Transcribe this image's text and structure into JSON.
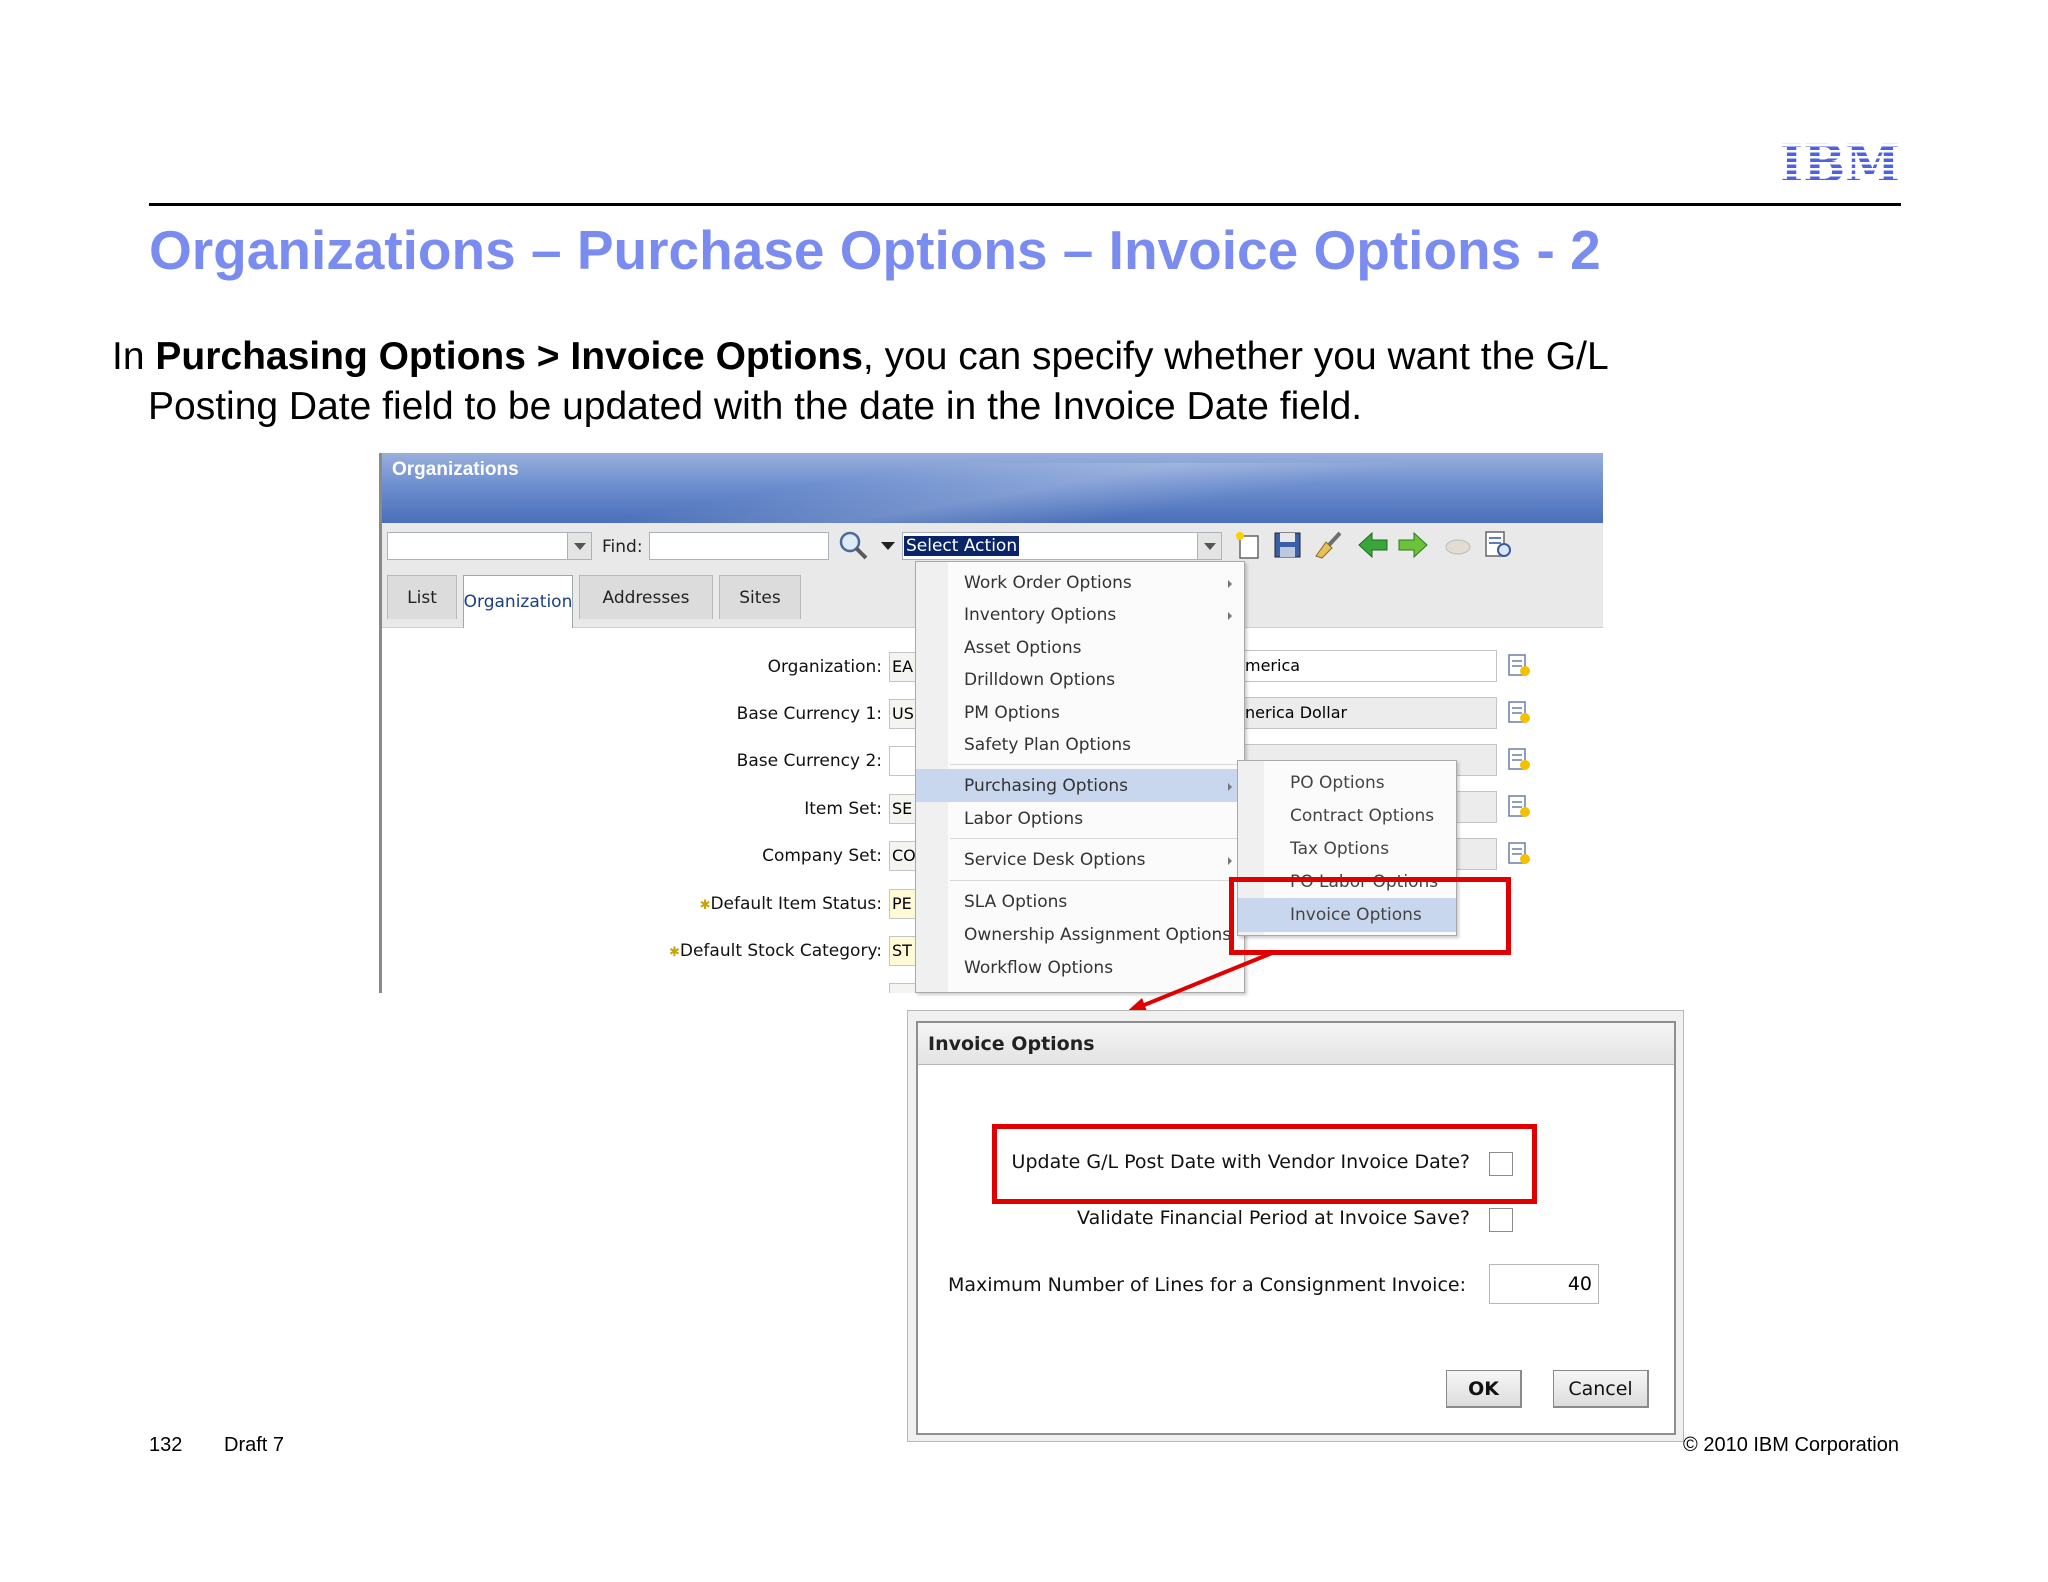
{
  "slide": {
    "logo_text": "IBM",
    "title": "Organizations – Purchase Options – Invoice Options - 2",
    "body": {
      "prefix": "In ",
      "bold": "Purchasing Options > Invoice Options",
      "rest_line1": ", you can specify whether you want the G/L",
      "line2": "Posting Date field to be updated with the date in the Invoice Date field."
    },
    "footer": {
      "page_number": "132",
      "draft": "Draft 7",
      "copyright": "© 2010 IBM Corporation"
    }
  },
  "app": {
    "title": "Organizations",
    "toolbar": {
      "find_label": "Find:",
      "select_action": "Select Action"
    },
    "tabs": [
      {
        "label": "List"
      },
      {
        "label": "Organization"
      },
      {
        "label": "Addresses"
      },
      {
        "label": "Sites"
      }
    ],
    "fields": [
      {
        "label": "Organization:",
        "value": "EA",
        "desc": "merica"
      },
      {
        "label": "Base Currency 1:",
        "value": "US",
        "desc": "nerica Dollar"
      },
      {
        "label": "Base Currency 2:",
        "value": "",
        "desc": ""
      },
      {
        "label": "Item Set:",
        "value": "SE",
        "desc": ""
      },
      {
        "label": "Company Set:",
        "value": "CO",
        "desc": ""
      },
      {
        "label": "Default Item Status:",
        "value": "PE",
        "required": true
      },
      {
        "label": "Default Stock Category:",
        "value": "ST",
        "required": true
      }
    ],
    "menu": [
      {
        "label": "Work Order Options",
        "submenu": true
      },
      {
        "label": "Inventory Options",
        "submenu": true
      },
      {
        "label": "Asset Options",
        "submenu": false
      },
      {
        "label": "Drilldown Options",
        "submenu": false
      },
      {
        "label": "PM Options",
        "submenu": false
      },
      {
        "label": "Safety Plan Options",
        "submenu": false
      },
      {
        "label": "Purchasing Options",
        "submenu": true
      },
      {
        "label": "Labor Options",
        "submenu": false
      },
      {
        "label": "Service Desk Options",
        "submenu": true
      },
      {
        "label": "SLA Options",
        "submenu": false
      },
      {
        "label": "Ownership Assignment Options",
        "submenu": false
      },
      {
        "label": "Workflow Options",
        "submenu": false
      }
    ],
    "submenu": [
      {
        "label": "PO Options"
      },
      {
        "label": "Contract Options"
      },
      {
        "label": "Tax Options"
      },
      {
        "label": "PO Labor Options"
      },
      {
        "label": "Invoice Options"
      }
    ]
  },
  "dialog": {
    "title": "Invoice Options",
    "update_gl_label": "Update G/L Post Date with Vendor Invoice Date?",
    "update_gl_checked": false,
    "validate_label": "Validate Financial Period at Invoice Save?",
    "validate_checked": false,
    "max_lines_label": "Maximum Number of Lines for a Consignment Invoice:",
    "max_lines_value": "40",
    "ok_label": "OK",
    "cancel_label": "Cancel"
  },
  "colors": {
    "title_blue": "#7b8cf0",
    "highlight_red": "#e00000",
    "menu_highlight": "#c9d7ee",
    "ibm_blue": "#4f60e0"
  }
}
